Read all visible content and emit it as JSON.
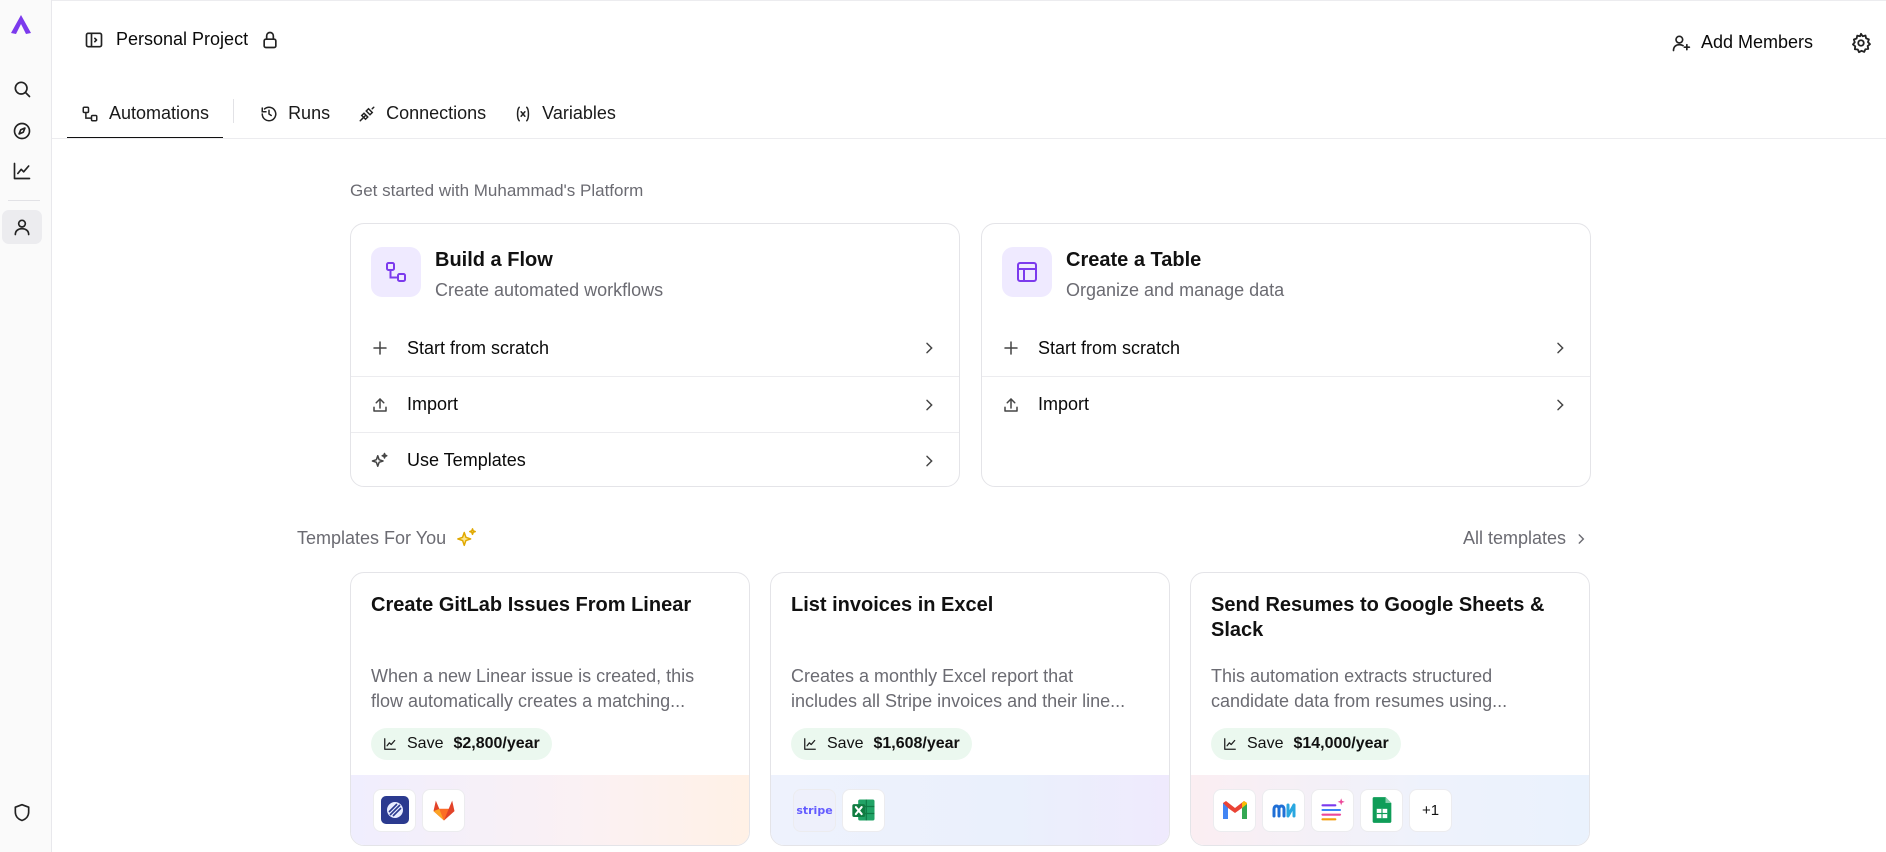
{
  "project": {
    "name": "Personal Project"
  },
  "header": {
    "add_members": "Add Members"
  },
  "tabs": [
    {
      "label": "Automations",
      "icon": "flow-icon",
      "active": true
    },
    {
      "label": "Runs",
      "icon": "history-icon",
      "active": false
    },
    {
      "label": "Connections",
      "icon": "plug-icon",
      "active": false
    },
    {
      "label": "Variables",
      "icon": "variable-icon",
      "active": false
    }
  ],
  "get_started": {
    "title": "Get started with Muhammad's Platform"
  },
  "build_flow": {
    "title": "Build a Flow",
    "subtitle": "Create automated workflows",
    "rows": [
      "Start from scratch",
      "Import",
      "Use Templates"
    ]
  },
  "create_table": {
    "title": "Create a Table",
    "subtitle": "Organize and manage data",
    "rows": [
      "Start from scratch",
      "Import"
    ]
  },
  "templates": {
    "title": "Templates For You",
    "all_link": "All templates",
    "items": [
      {
        "title": "Create GitLab Issues From Linear",
        "desc_line1": "When a new Linear issue is created, this",
        "desc_line2": "flow automatically creates a matching...",
        "save_label": "Save",
        "save_value": "$2,800/year",
        "apps": [
          "Linear",
          "GitLab"
        ]
      },
      {
        "title": "List invoices in Excel",
        "desc_line1": "Creates a monthly Excel report that",
        "desc_line2": "includes all Stripe invoices and their line...",
        "save_label": "Save",
        "save_value": "$1,608/year",
        "apps": [
          "Stripe",
          "Excel"
        ],
        "stripe_text": "stripe"
      },
      {
        "title": "Send Resumes to Google Sheets & Slack",
        "desc_line1": "This automation extracts structured",
        "desc_line2": "candidate data from resumes using...",
        "save_label": "Save",
        "save_value": "$14,000/year",
        "apps": [
          "Gmail",
          "Monday",
          "AI",
          "Google Sheets"
        ],
        "more": "+1"
      }
    ]
  },
  "colors": {
    "accent": "#7c3aed",
    "save_bg": "#ebf8ef"
  }
}
